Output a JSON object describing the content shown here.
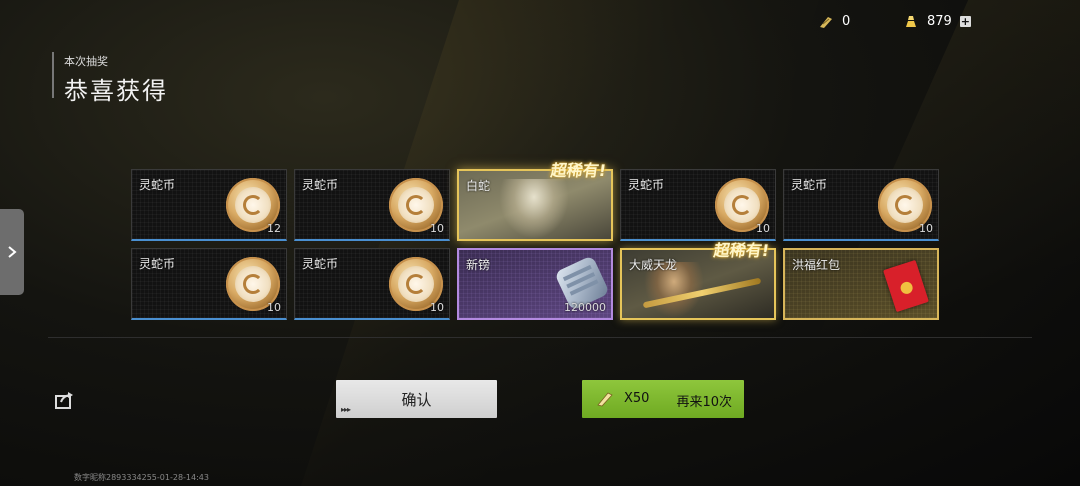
{
  "currency": {
    "ticket_count": "0",
    "gold_count": "879",
    "plus_symbol": "+"
  },
  "header": {
    "subtitle": "本次抽奖",
    "title": "恭喜获得"
  },
  "cards": [
    {
      "name": "灵蛇币",
      "count": "12"
    },
    {
      "name": "灵蛇币",
      "count": "10"
    },
    {
      "name": "白蛇",
      "count": "",
      "tag": "超稀有!"
    },
    {
      "name": "灵蛇币",
      "count": "10"
    },
    {
      "name": "灵蛇币",
      "count": "10"
    },
    {
      "name": "灵蛇币",
      "count": "10"
    },
    {
      "name": "灵蛇币",
      "count": "10"
    },
    {
      "name": "新镑",
      "count": "120000"
    },
    {
      "name": "大威天龙",
      "count": "",
      "tag": "超稀有!"
    },
    {
      "name": "洪福红包",
      "count": ""
    }
  ],
  "buttons": {
    "confirm_label": "确认",
    "again_multiplier": "X50",
    "again_label": "再来10次",
    "dots": "▸▸▸"
  },
  "footer": {
    "id_text": "数字昵称2893334255-01-28-14:43"
  },
  "colors": {
    "accent_green": "#8ec63c",
    "rare_gold": "#e6c55a",
    "purple": "#b38ae0",
    "blue_underline": "#4a8fd0"
  },
  "icons": {
    "ticket": "ticket-icon",
    "gold": "gold-bars-icon",
    "share": "share-icon",
    "side_arrow": "chevron-right-icon"
  }
}
